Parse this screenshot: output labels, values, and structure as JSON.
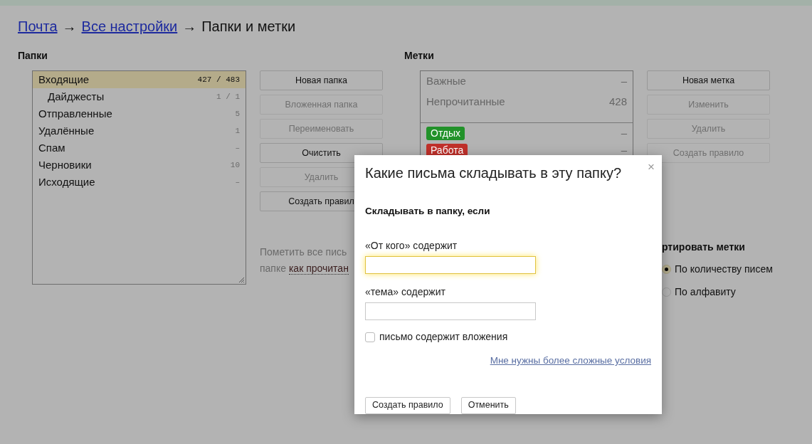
{
  "breadcrumb": [
    {
      "kind": "link",
      "text": "Почта"
    },
    {
      "kind": "separator",
      "text": "→"
    },
    {
      "kind": "link",
      "text": "Все настройки"
    },
    {
      "kind": "separator",
      "text": "→"
    },
    {
      "kind": "current",
      "text": "Папки и метки"
    }
  ],
  "folders": {
    "title": "Папки",
    "items": [
      {
        "name": "Входящие",
        "count": "427 / 483",
        "selected": true,
        "children": [
          {
            "name": "Дайджесты",
            "count": "1 / 1",
            "selected": false
          }
        ]
      },
      {
        "name": "Отправленные",
        "count": "5",
        "selected": false
      },
      {
        "name": "Удалённые",
        "count": "1",
        "selected": false
      },
      {
        "name": "Спам",
        "count": "–",
        "selected": false
      },
      {
        "name": "Черновики",
        "count": "10",
        "selected": false
      },
      {
        "name": "Исходящие",
        "count": "–",
        "selected": false
      }
    ]
  },
  "folder_buttons": [
    {
      "label": "Новая папка",
      "disabled": false
    },
    {
      "label": "Вложенная папка",
      "disabled": true
    },
    {
      "label": "Переименовать",
      "disabled": true
    },
    {
      "label": "Очистить",
      "disabled": false
    },
    {
      "label": "Удалить",
      "disabled": true
    },
    {
      "label": "Создать правил",
      "disabled": false
    }
  ],
  "mark_read": {
    "text": "Пометить все пись",
    "text_2": "папке",
    "link": "как прочитан"
  },
  "labels": {
    "title": "Метки",
    "system": [
      {
        "name": "Важные",
        "count": "–"
      },
      {
        "name": "Непрочитанные",
        "count": "428"
      }
    ],
    "user": [
      {
        "name": "Отдых",
        "count": "–",
        "color": "#22922a"
      },
      {
        "name": "Работа",
        "count": "–",
        "color": "#c0302a"
      }
    ]
  },
  "label_buttons": [
    {
      "label": "Новая метка",
      "disabled": false
    },
    {
      "label": "Изменить",
      "disabled": true
    },
    {
      "label": "Удалить",
      "disabled": true
    },
    {
      "label": "Создать правило",
      "disabled": true
    }
  ],
  "sort": {
    "title": "ртировать метки",
    "options": [
      {
        "label": "По количеству писем",
        "selected": true
      },
      {
        "label": "По алфавиту",
        "selected": false
      }
    ]
  },
  "dialog": {
    "title": "Какие письма складывать в эту папку?",
    "close": "×",
    "subtitle": "Складывать в папку, если",
    "fields": [
      {
        "label": "«От кого» содержит",
        "focused": true
      },
      {
        "label": "«тема» содержит",
        "focused": false
      }
    ],
    "attachment": {
      "label": "письмо содержит вложения",
      "checked": false
    },
    "link": "Мне нужны более сложные условия",
    "buttons": [
      "Создать правило",
      "Отменить"
    ]
  }
}
